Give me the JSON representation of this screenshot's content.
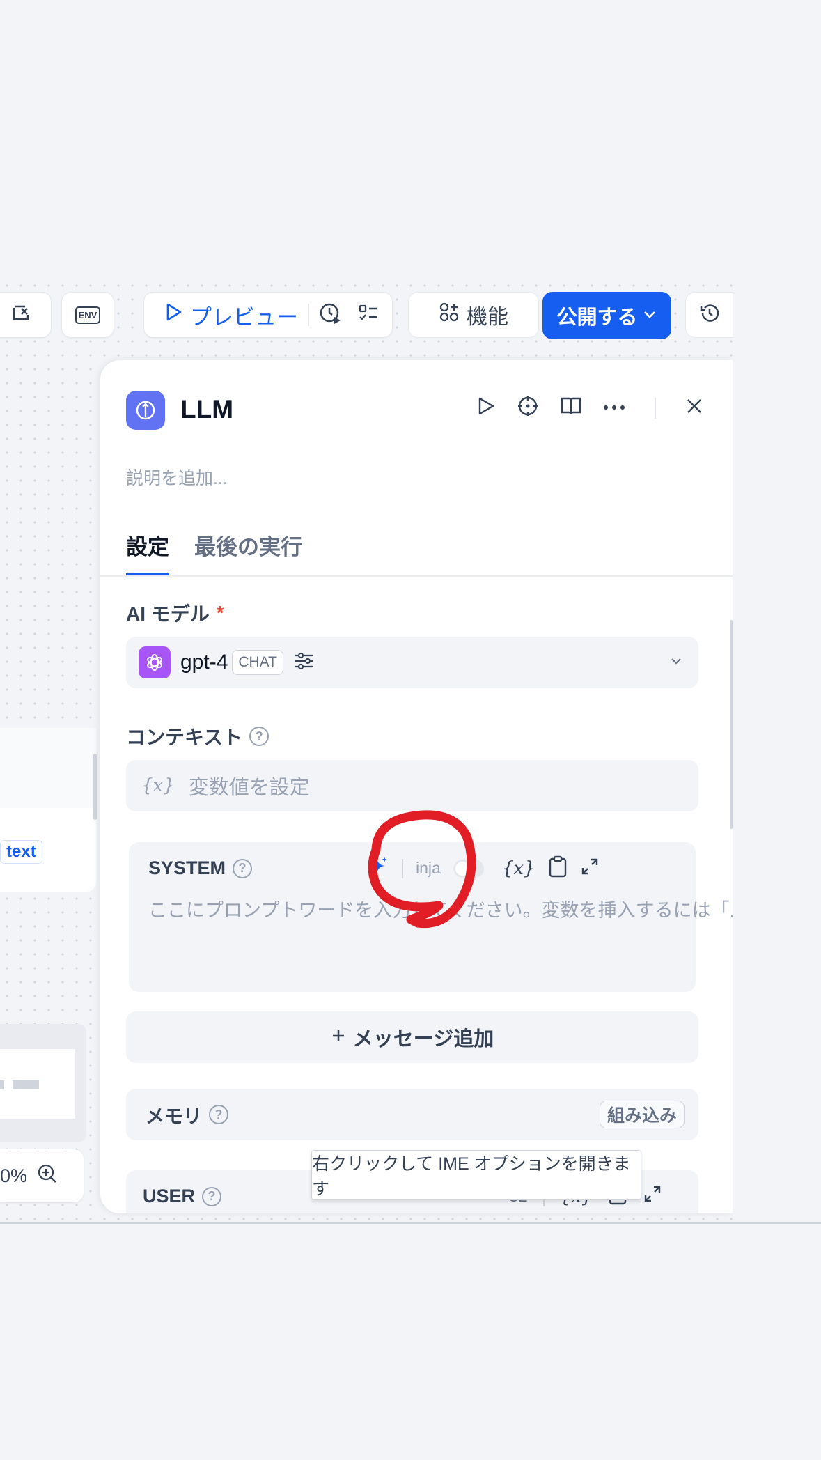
{
  "toolbar": {
    "preview_label": "プレビュー",
    "features_label": "機能",
    "publish_label": "公開する",
    "env_label": "ENV"
  },
  "canvas": {
    "text_tag": "text",
    "zoom_value": "0%"
  },
  "panel": {
    "title": "LLM",
    "description_placeholder": "説明を追加...",
    "tabs": [
      {
        "label": "設定",
        "active": true
      },
      {
        "label": "最後の実行",
        "active": false
      }
    ],
    "model": {
      "label": "AI モデル",
      "required": "*",
      "name": "gpt-4",
      "mode_badge": "CHAT"
    },
    "context": {
      "label": "コンテキスト",
      "var_icon": "{x}",
      "placeholder": "変数値を設定"
    },
    "system": {
      "label": "SYSTEM",
      "jinja_label": "inja",
      "var_icon": "{x}",
      "placeholder": "ここにプロンプトワードを入力してください。変数を挿入するには「..."
    },
    "add_message_label": "メッセージ追加",
    "memory": {
      "label": "メモリ",
      "builtin_label": "組み込み"
    },
    "user": {
      "label": "USER",
      "count": "32",
      "var_icon": "{x}"
    }
  },
  "tooltip": "右クリックして IME オプションを開きます",
  "colors": {
    "accent": "#155eef",
    "node_icon": "#6172f3",
    "model_logo": "#a855f7",
    "annotation": "#e11d26"
  }
}
